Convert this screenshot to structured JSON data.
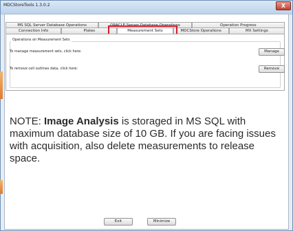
{
  "window": {
    "title": "MDCStoreTools 1.3.0.2",
    "close_glyph": "X"
  },
  "tabs": {
    "back_row": [
      "MS SQL Server Database Operations",
      "ORACLE Server Database Operations",
      "Operation Progress"
    ],
    "front_row": [
      "Connection Info",
      "Plates",
      "Measurement Sets",
      "MDCStore Operations",
      "MX Settings"
    ],
    "selected": "Measurement Sets"
  },
  "measurement_sets": {
    "group_title": "Operations on Measurement Sets",
    "manage_text": "To manage measurement sets, click here:",
    "manage_button": "Manage",
    "remove_text": "To remove cell outlines data, click here:",
    "remove_button": "Remove"
  },
  "note": {
    "prefix": "NOTE: ",
    "emphasis": "Image Analysis",
    "body": " is storaged in MS SQL with maximum database size of 10 GB. If you are facing issues with acquisition, also delete measurements to release space."
  },
  "footer": {
    "exit_button": "Exit",
    "minimize_button": "Minimize"
  },
  "colors": {
    "highlight": "#d21a2d",
    "title_bar": "#bed4ec",
    "close_button": "#c4412f"
  }
}
